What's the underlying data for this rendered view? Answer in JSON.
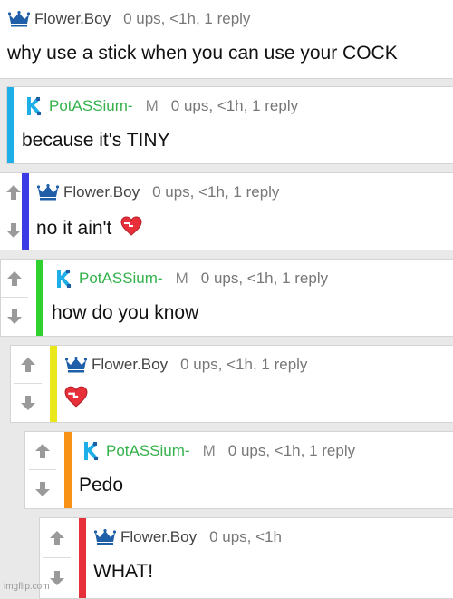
{
  "comments": [
    {
      "username": "Flower.Boy",
      "mod": "",
      "meta": "0 ups, <1h, 1 reply",
      "text": "why use a stick when you can use your COCK",
      "avatar": "crown-icon",
      "bar_color": "",
      "has_votes": false
    },
    {
      "username": "PotASSium-",
      "mod": "M",
      "meta": "0 ups, <1h, 1 reply",
      "text": "because it's TINY",
      "avatar": "potassium-logo-icon",
      "bar_color": "#1eaee8",
      "has_votes": false
    },
    {
      "username": "Flower.Boy",
      "mod": "",
      "meta": "0 ups, <1h, 1 reply",
      "text": "no it ain't",
      "avatar": "crown-icon",
      "bar_color": "#3c3ce6",
      "has_votes": true,
      "emoji": "heart-icon"
    },
    {
      "username": "PotASSium-",
      "mod": "M",
      "meta": "0 ups, <1h, 1 reply",
      "text": "how do you know",
      "avatar": "potassium-logo-icon",
      "bar_color": "#2fd12f",
      "has_votes": true
    },
    {
      "username": "Flower.Boy",
      "mod": "",
      "meta": "0 ups, <1h, 1 reply",
      "text": "",
      "avatar": "crown-icon",
      "bar_color": "#e8e81a",
      "has_votes": true,
      "emoji": "heart-icon"
    },
    {
      "username": "PotASSium-",
      "mod": "M",
      "meta": "0 ups, <1h, 1 reply",
      "text": "Pedo",
      "avatar": "potassium-logo-icon",
      "bar_color": "#f79216",
      "has_votes": true
    },
    {
      "username": "Flower.Boy",
      "mod": "",
      "meta": "0 ups, <1h",
      "text": "WHAT!",
      "avatar": "crown-icon",
      "bar_color": "#e8303a",
      "has_votes": true
    }
  ],
  "watermark": "imgflip.com"
}
